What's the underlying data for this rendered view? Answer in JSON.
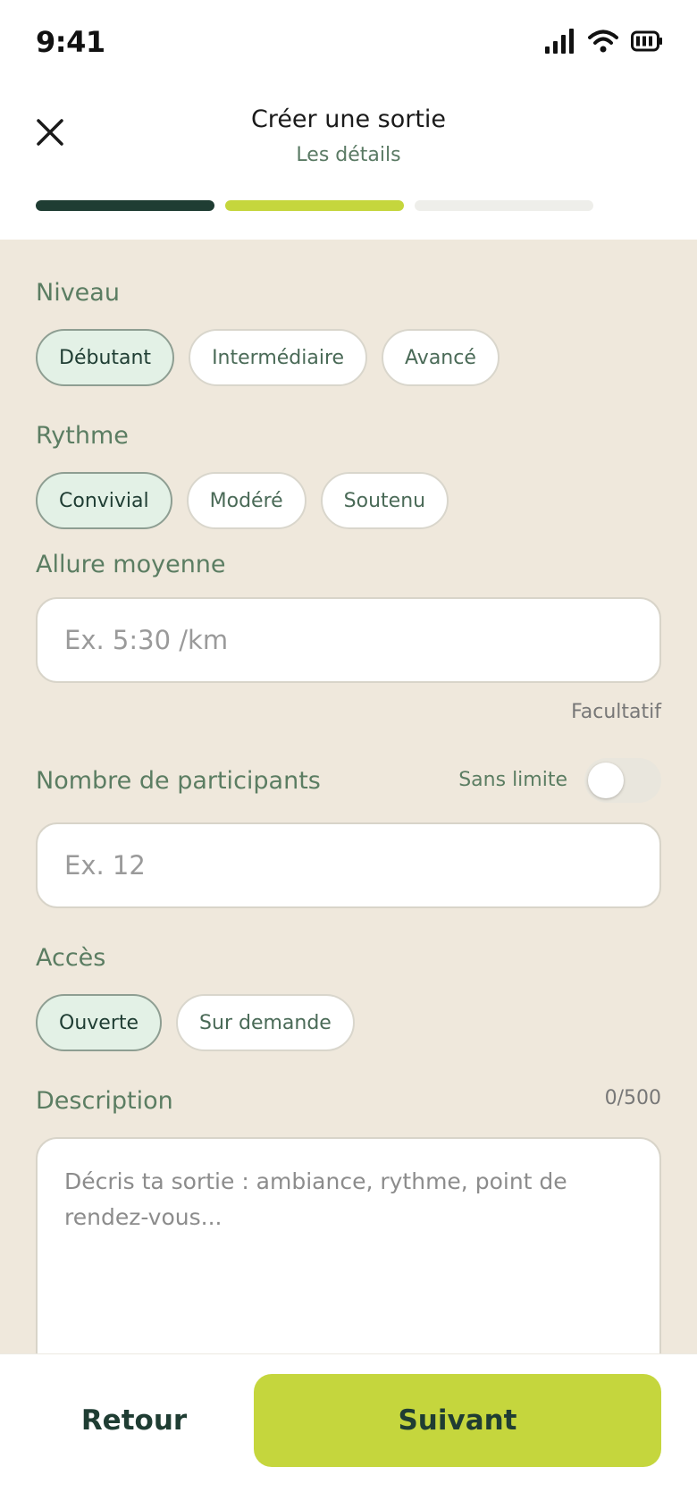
{
  "status_bar": {
    "time": "9:41"
  },
  "header": {
    "title": "Créer une sortie",
    "subtitle": "Les détails"
  },
  "progress": {
    "current_step": 2,
    "total_steps": 3
  },
  "colors": {
    "accent": "#c5d63d",
    "dark": "#1f3d33",
    "background": "#efe8dc",
    "label": "#5b7d62"
  },
  "level": {
    "label": "Niveau",
    "options": [
      "Débutant",
      "Intermédiaire",
      "Avancé"
    ],
    "selected": "Débutant"
  },
  "rhythm": {
    "label": "Rythme",
    "options": [
      "Convivial",
      "Modéré",
      "Soutenu"
    ],
    "selected": "Convivial"
  },
  "pace": {
    "label": "Allure moyenne",
    "placeholder": "Ex. 5:30 /km",
    "hint": "Facultatif"
  },
  "participants": {
    "label": "Nombre de participants",
    "toggle_label": "Sans limite",
    "toggle_on": false,
    "placeholder": "Ex. 12"
  },
  "access": {
    "label": "Accès",
    "options": [
      "Ouverte",
      "Sur demande"
    ],
    "selected": "Ouverte"
  },
  "description": {
    "label": "Description",
    "counter": "0/500",
    "placeholder": "Décris ta sortie : ambiance, rythme, point de rendez-vous..."
  },
  "footer": {
    "back_label": "Retour",
    "next_label": "Suivant"
  },
  "icons": [
    "signal-icon",
    "wifi-icon",
    "battery-icon",
    "close-icon"
  ]
}
